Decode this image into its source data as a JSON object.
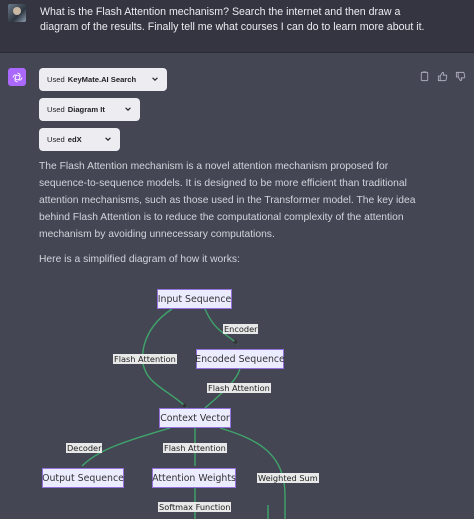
{
  "user_message": "What is the Flash Attention mechanism? Search the internet and then draw a diagram of the results. Finally tell me what courses I can do to learn more about it.",
  "plugins": [
    {
      "prefix": "Used",
      "name": "KeyMate.AI Search"
    },
    {
      "prefix": "Used",
      "name": "Diagram It"
    },
    {
      "prefix": "Used",
      "name": "edX"
    }
  ],
  "answer": {
    "paragraph1": "The Flash Attention mechanism is a novel attention mechanism proposed for sequence-to-sequence models. It is designed to be more efficient than traditional attention mechanisms, such as those used in the Transformer model. The key idea behind Flash Attention is to reduce the computational complexity of the attention mechanism by avoiding unnecessary computations.",
    "paragraph2": "Here is a simplified diagram of how it works:"
  },
  "diagram": {
    "nodes": {
      "input_sequence": "Input Sequence",
      "encoded_sequence": "Encoded Sequence",
      "context_vector": "Context Vector",
      "output_sequence": "Output Sequence",
      "attention_weights": "Attention Weights"
    },
    "edges": {
      "encoder": "Encoder",
      "flash_attention_left": "Flash Attention",
      "flash_attention_mid": "Flash Attention",
      "decoder": "Decoder",
      "flash_attention_right": "Flash Attention",
      "weighted_sum": "Weighted Sum",
      "softmax_function": "Softmax Function"
    },
    "colors": {
      "node_fill": "#ececff",
      "node_border": "#9370db",
      "edge": "#3fa46a"
    }
  },
  "icons": {
    "actions": [
      "copy-icon",
      "thumbs-up-icon",
      "thumbs-down-icon"
    ],
    "chip": "chevron-down-icon",
    "assistant": "openai-logo-icon"
  },
  "colors": {
    "assistant_avatar": "#ab68ff",
    "background": "#444654",
    "user_bg": "#343541"
  }
}
